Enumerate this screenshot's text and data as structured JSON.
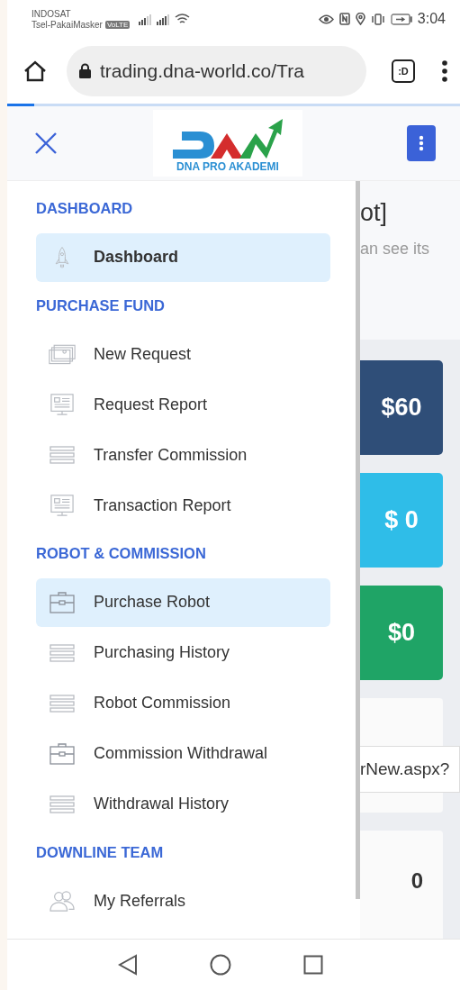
{
  "status_bar": {
    "carrier_1": "INDOSAT",
    "carrier_2": "Tsel-PakaiMasker",
    "volte_badge": "VoLTE",
    "time": "3:04"
  },
  "browser": {
    "url": "trading.dna-world.co/Tra",
    "tab_button": ":D",
    "progress": {
      "level": 0.06
    }
  },
  "app_header": {
    "logo_text": "DNA PRO AKADEMI"
  },
  "sidebar": {
    "sections": [
      {
        "heading": "DASHBOARD",
        "items": [
          {
            "label": "Dashboard",
            "kind": "rocket",
            "selected": true
          }
        ]
      },
      {
        "heading": "PURCHASE FUND",
        "items": [
          {
            "label": "New Request",
            "kind": "money",
            "selected": false
          },
          {
            "label": "Request Report",
            "kind": "monitor",
            "selected": false
          },
          {
            "label": "Transfer Commission",
            "kind": "list",
            "selected": false
          },
          {
            "label": "Transaction Report",
            "kind": "monitor",
            "selected": false
          }
        ]
      },
      {
        "heading": "ROBOT & COMMISSION",
        "items": [
          {
            "label": "Purchase Robot",
            "kind": "briefcase",
            "selected": true
          },
          {
            "label": "Purchasing History",
            "kind": "list",
            "selected": false
          },
          {
            "label": "Robot Commission",
            "kind": "list",
            "selected": false
          },
          {
            "label": "Commission Withdrawal",
            "kind": "briefcase",
            "selected": false
          },
          {
            "label": "Withdrawal History",
            "kind": "list",
            "selected": false
          }
        ]
      },
      {
        "heading": "DOWNLINE TEAM",
        "items": [
          {
            "label": "My Referrals",
            "kind": "people",
            "selected": false
          }
        ]
      }
    ]
  },
  "content": {
    "title_fragment": "ot]",
    "subtitle_fragment": "an see its",
    "stat_cards": [
      {
        "value": "$60",
        "color": "#2f4e78"
      },
      {
        "value": "$ 0",
        "color": "#2fbde8"
      },
      {
        "value": "$0",
        "color": "#1fa466"
      }
    ],
    "tooltip": "rNew.aspx?",
    "count_value": "0"
  }
}
